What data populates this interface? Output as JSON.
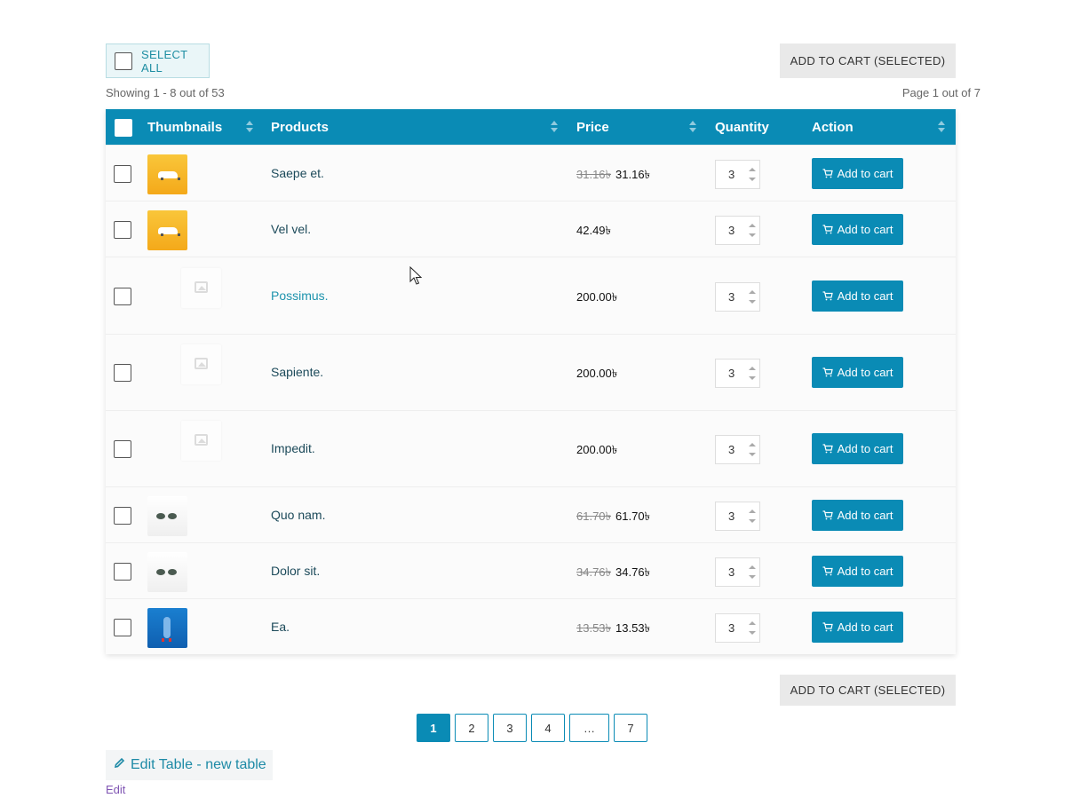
{
  "select_all": {
    "label": "SELECT ALL"
  },
  "add_selected": {
    "label": "ADD TO CART (SELECTED)"
  },
  "info": {
    "showing": "Showing 1 - 8 out of 53",
    "page": "Page 1 out of 7"
  },
  "table": {
    "headers": {
      "thumbnails": "Thumbnails",
      "products": "Products",
      "price": "Price",
      "quantity": "Quantity",
      "action": "Action"
    },
    "rows": [
      {
        "name": "Saepe et.",
        "old_price": "31.16৳",
        "price": "31.16৳",
        "qty": "3",
        "action": "Add to cart",
        "thumb": "car-yellow"
      },
      {
        "name": "Vel vel.",
        "old_price": "",
        "price": "42.49৳",
        "qty": "3",
        "action": "Add to cart",
        "thumb": "car-yellow"
      },
      {
        "name": "Possimus.",
        "old_price": "",
        "price": "200.00৳",
        "qty": "3",
        "action": "Add to cart",
        "thumb": "placeholder"
      },
      {
        "name": "Sapiente.",
        "old_price": "",
        "price": "200.00৳",
        "qty": "3",
        "action": "Add to cart",
        "thumb": "placeholder"
      },
      {
        "name": "Impedit.",
        "old_price": "",
        "price": "200.00৳",
        "qty": "3",
        "action": "Add to cart",
        "thumb": "placeholder"
      },
      {
        "name": "Quo nam.",
        "old_price": "61.70৳",
        "price": "61.70৳",
        "qty": "3",
        "action": "Add to cart",
        "thumb": "sunglasses"
      },
      {
        "name": "Dolor sit.",
        "old_price": "34.76৳",
        "price": "34.76৳",
        "qty": "3",
        "action": "Add to cart",
        "thumb": "sunglasses"
      },
      {
        "name": "Ea.",
        "old_price": "13.53৳",
        "price": "13.53৳",
        "qty": "3",
        "action": "Add to cart",
        "thumb": "blue-figure"
      }
    ]
  },
  "pagination": {
    "pages": [
      "1",
      "2",
      "3",
      "4",
      "…",
      "7"
    ],
    "current": "1"
  },
  "edit_table": {
    "label": "Edit Table - new table"
  },
  "edit_link": {
    "label": "Edit"
  },
  "colors": {
    "accent": "#0a8bb5",
    "link": "#1d8aa6",
    "edit": "#7f54b3"
  },
  "icons": {
    "cart": "cart-icon",
    "pencil": "pencil-icon",
    "placeholder": "image-placeholder-icon"
  }
}
